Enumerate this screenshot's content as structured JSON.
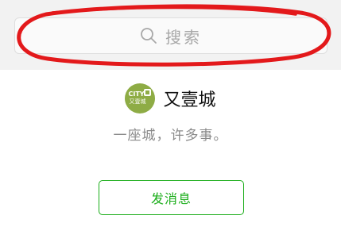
{
  "search": {
    "placeholder": "搜索",
    "icon": "search-icon"
  },
  "annotation": {
    "color": "#e3191b",
    "shape": "hand-drawn ellipse around search bar"
  },
  "profile": {
    "logo": {
      "line1": "CITY",
      "line2": "又壹城",
      "background": "#8eac45"
    },
    "name": "又壹城",
    "tagline": "一座城，许多事。"
  },
  "actions": {
    "send_message_label": "发消息",
    "accent": "#1aad19"
  }
}
